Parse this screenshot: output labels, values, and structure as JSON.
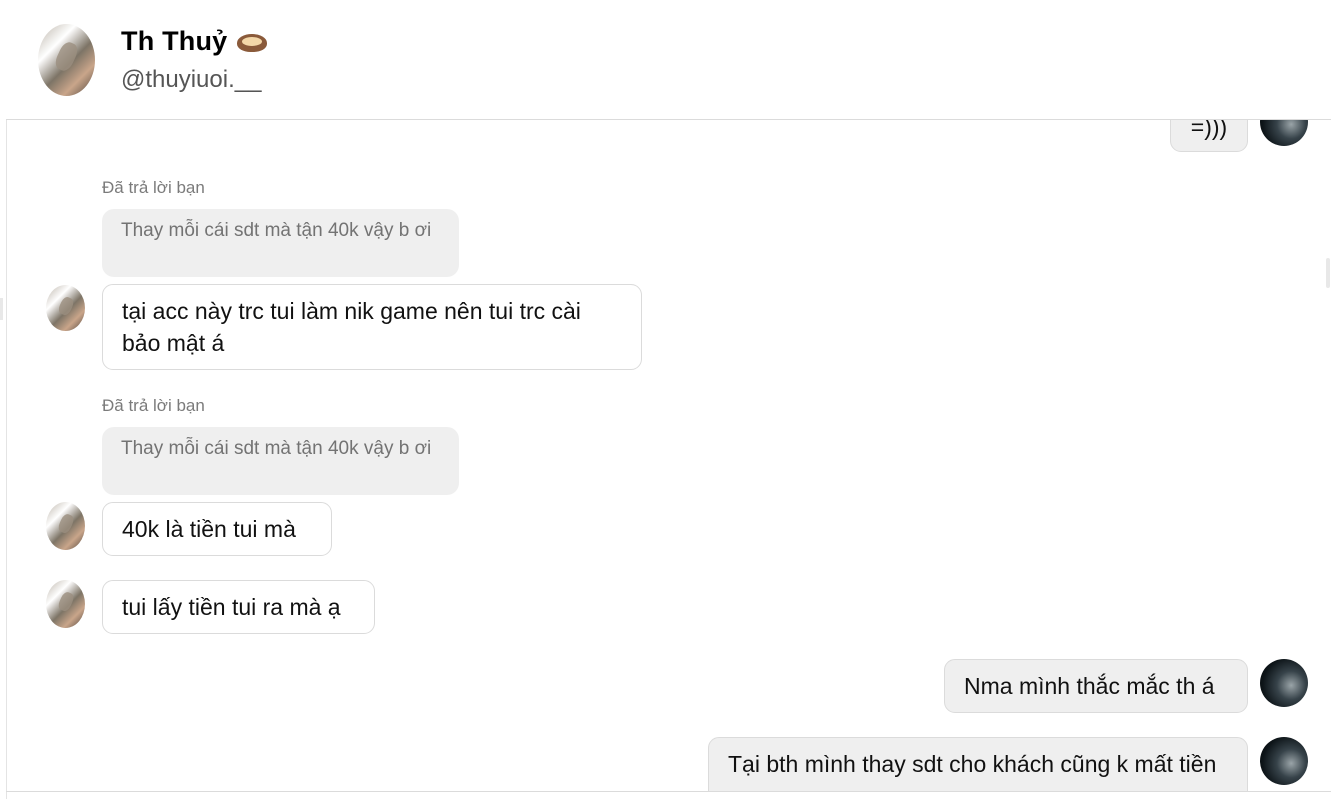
{
  "header": {
    "name": "Th Thuỷ",
    "emoji_icon": "mustache-emoji-icon",
    "handle": "@thuyiuoi.__"
  },
  "messages": {
    "m0": {
      "text": "=)))"
    },
    "reply1": {
      "label": "Đã trả lời bạn",
      "quote": "Thay mỗi cái sdt mà tận 40k vậy b ơi"
    },
    "m1": {
      "text": "tại acc này trc tui làm nik game nên tui trc cài bảo mật á"
    },
    "reply2": {
      "label": "Đã trả lời bạn",
      "quote": "Thay mỗi cái sdt mà tận 40k vậy b ơi"
    },
    "m2": {
      "text": "40k là tiền tui mà"
    },
    "m3": {
      "text": "tui lấy tiền tui ra mà ạ"
    },
    "m4": {
      "text": "Nma mình thắc mắc th á"
    },
    "m5": {
      "text": "Tại bth mình thay sdt cho khách cũng k mất tiền"
    }
  },
  "colors": {
    "border": "#dbdbdb",
    "my_bubble": "#efefef",
    "quote_bg": "#efefef",
    "muted_text": "#737373"
  }
}
